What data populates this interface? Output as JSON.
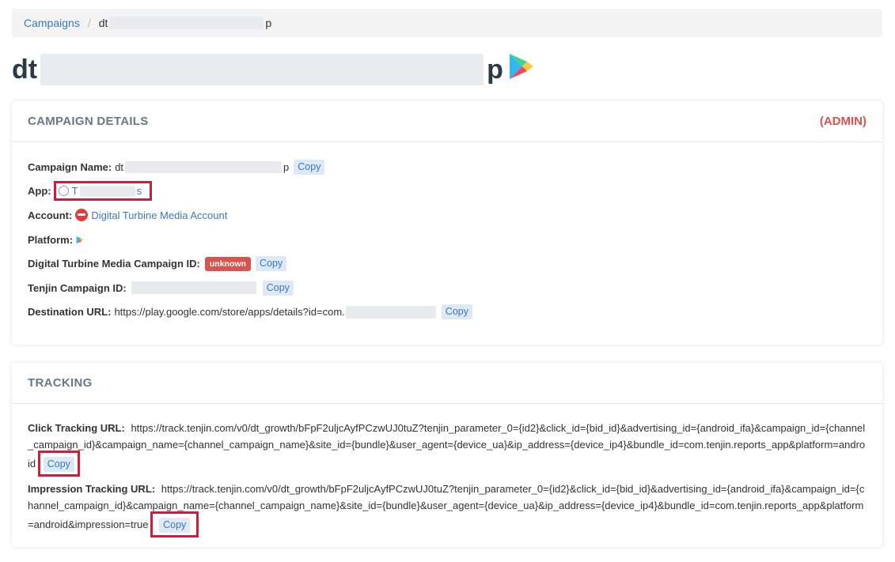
{
  "breadcrumb": {
    "root": "Campaigns",
    "separator": "/",
    "current_prefix": "dt",
    "current_suffix": "p"
  },
  "title": {
    "prefix": "dt",
    "suffix": "p",
    "platform_icon": "google-play-icon"
  },
  "campaign_details": {
    "header": "CAMPAIGN DETAILS",
    "admin_label": "(ADMIN)",
    "campaign_name": {
      "label": "Campaign Name:",
      "value_prefix": "dt",
      "value_suffix": "p",
      "copy": "Copy"
    },
    "app": {
      "label": "App:",
      "value_prefix": "T",
      "value_suffix": "s",
      "icon": "app-icon"
    },
    "account": {
      "label": "Account:",
      "value": "Digital Turbine Media Account",
      "icon": "account-logo-icon"
    },
    "platform": {
      "label": "Platform:",
      "icon": "google-play-icon"
    },
    "dt_campaign_id": {
      "label": "Digital Turbine Media Campaign ID:",
      "badge": "unknown",
      "copy": "Copy"
    },
    "tenjin_campaign_id": {
      "label": "Tenjin Campaign ID:",
      "copy": "Copy"
    },
    "destination_url": {
      "label": "Destination URL:",
      "value": "https://play.google.com/store/apps/details?id=com.",
      "copy": "Copy"
    }
  },
  "tracking": {
    "header": "TRACKING",
    "click": {
      "label": "Click Tracking URL:",
      "value": "https://track.tenjin.com/v0/dt_growth/bFpF2uljcAyfPCzwUJ0tuZ?tenjin_parameter_0={id2}&click_id={bid_id}&advertising_id={android_ifa}&campaign_id={channel_campaign_id}&campaign_name={channel_campaign_name}&site_id={bundle}&user_agent={device_ua}&ip_address={device_ip4}&bundle_id=com.tenjin.reports_app&platform=android",
      "copy": "Copy"
    },
    "impression": {
      "label": "Impression Tracking URL:",
      "value": "https://track.tenjin.com/v0/dt_growth/bFpF2uljcAyfPCzwUJ0tuZ?tenjin_parameter_0={id2}&click_id={bid_id}&advertising_id={android_ifa}&campaign_id={channel_campaign_id}&campaign_name={channel_campaign_name}&site_id={bundle}&user_agent={device_ua}&ip_address={device_ip4}&bundle_id=com.tenjin.reports_app&platform=android&impression=true",
      "copy": "Copy"
    }
  },
  "colors": {
    "link": "#3d78b6",
    "admin": "#d9534f",
    "highlight": "#cc1f3b",
    "copy_bg": "#dde9f5"
  }
}
